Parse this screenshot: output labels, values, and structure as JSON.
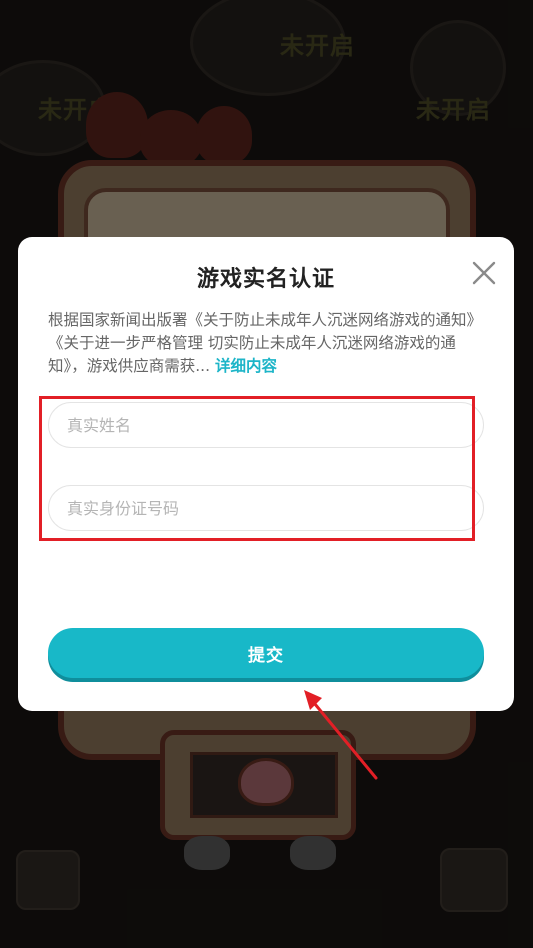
{
  "background": {
    "locked_labels": [
      "未开启",
      "未开启",
      "未开启"
    ]
  },
  "dialog": {
    "title": "游戏实名认证",
    "notice_text": "根据国家新闻出版署《关于防止未成年人沉迷网络游戏的通知》《关于进一步严格管理 切实防止未成年人沉迷网络游戏的通知》，游戏供应商需获...",
    "more_link": "详细内容",
    "name_field": {
      "placeholder": "真实姓名",
      "value": ""
    },
    "id_field": {
      "placeholder": "真实身份证号码",
      "value": ""
    },
    "submit_label": "提交"
  },
  "colors": {
    "accent": "#18b8c8",
    "link": "#1db5c8",
    "highlight": "#e21f26"
  },
  "icons": [
    "close-icon",
    "arrow-annotation"
  ]
}
